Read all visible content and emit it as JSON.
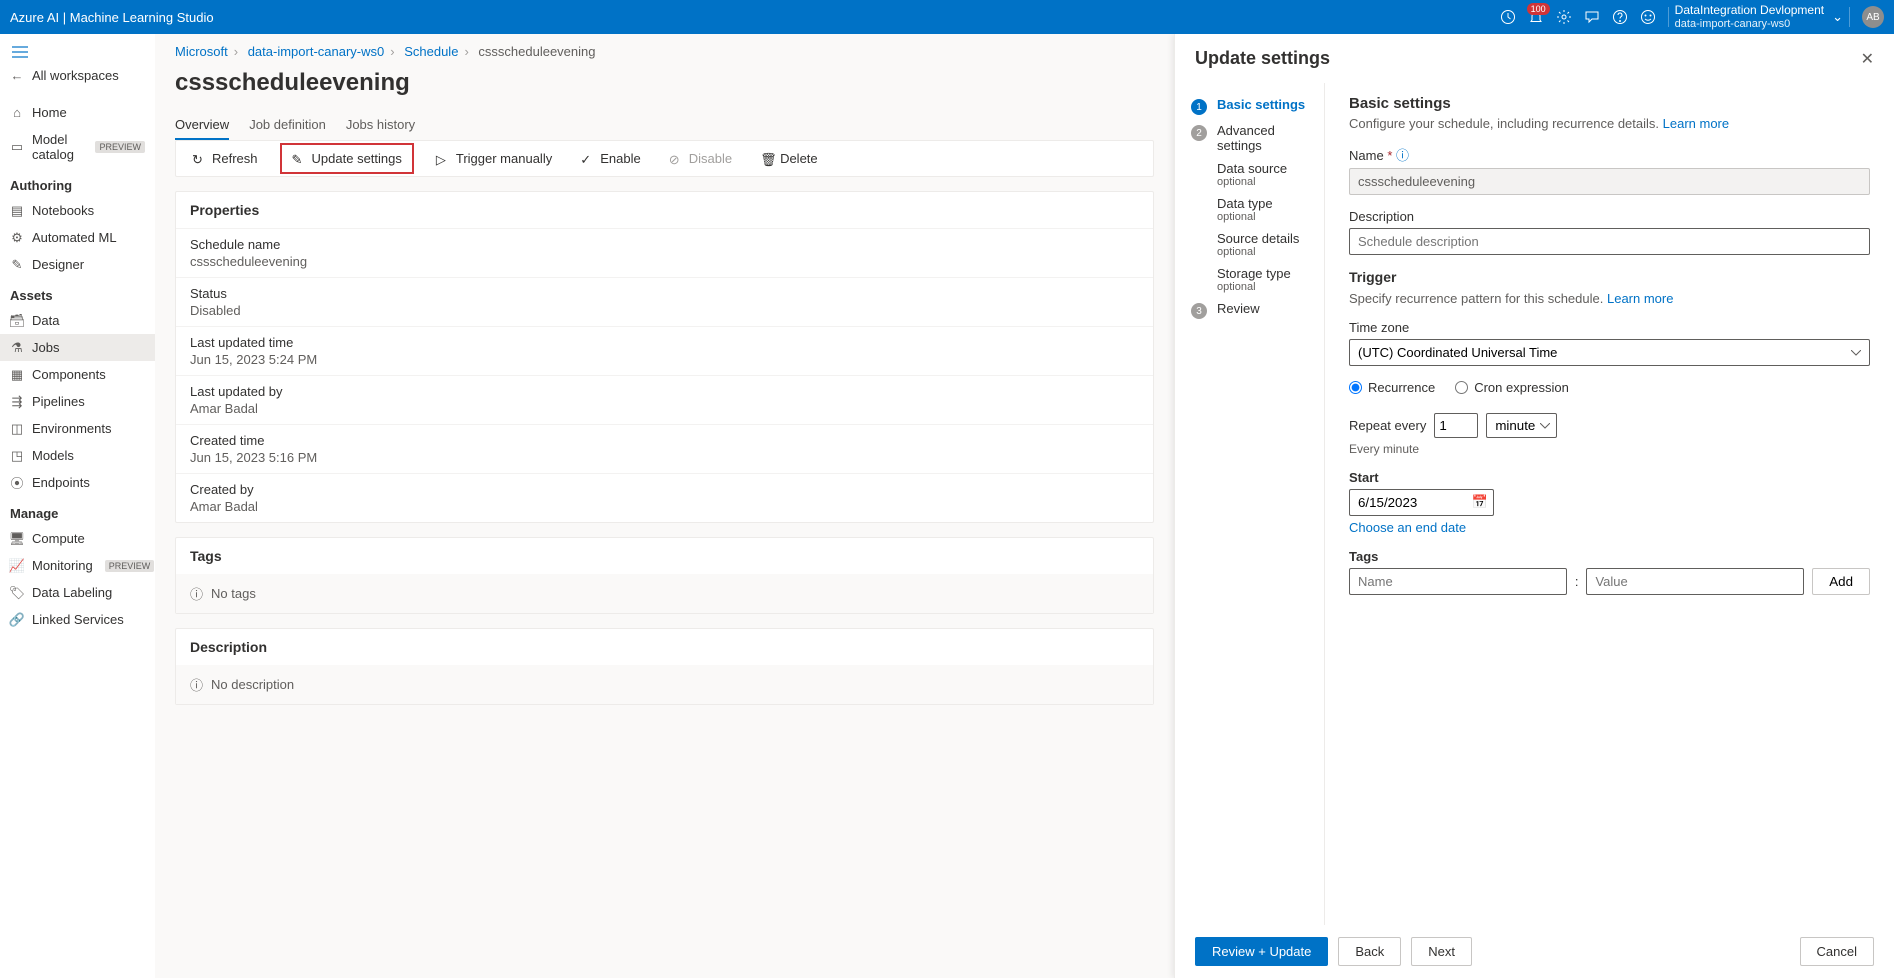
{
  "header": {
    "brand": "Azure AI | Machine Learning Studio",
    "notification_count": "100",
    "tenant": "DataIntegration Devlopment",
    "workspace": "data-import-canary-ws0",
    "avatar_initials": "AB"
  },
  "nav": {
    "all_workspaces": "All workspaces",
    "home": "Home",
    "model_catalog": "Model catalog",
    "preview_badge": "PREVIEW",
    "section_authoring": "Authoring",
    "notebooks": "Notebooks",
    "automated_ml": "Automated ML",
    "designer": "Designer",
    "section_assets": "Assets",
    "data": "Data",
    "jobs": "Jobs",
    "components": "Components",
    "pipelines": "Pipelines",
    "environments": "Environments",
    "models": "Models",
    "endpoints": "Endpoints",
    "section_manage": "Manage",
    "compute": "Compute",
    "monitoring": "Monitoring",
    "data_labeling": "Data Labeling",
    "linked_services": "Linked Services"
  },
  "breadcrumb": {
    "microsoft": "Microsoft",
    "workspace": "data-import-canary-ws0",
    "schedule": "Schedule",
    "current": "cssscheduleevening"
  },
  "page_title": "cssscheduleevening",
  "tabs": {
    "overview": "Overview",
    "job_def": "Job definition",
    "jobs_history": "Jobs history"
  },
  "toolbar": {
    "refresh": "Refresh",
    "update_settings": "Update settings",
    "trigger_manually": "Trigger manually",
    "enable": "Enable",
    "disable": "Disable",
    "delete": "Delete"
  },
  "properties": {
    "title": "Properties",
    "schedule_name_k": "Schedule name",
    "schedule_name_v": "cssscheduleevening",
    "status_k": "Status",
    "status_v": "Disabled",
    "last_updated_time_k": "Last updated time",
    "last_updated_time_v": "Jun 15, 2023 5:24 PM",
    "last_updated_by_k": "Last updated by",
    "last_updated_by_v": "Amar Badal",
    "created_time_k": "Created time",
    "created_time_v": "Jun 15, 2023 5:16 PM",
    "created_by_k": "Created by",
    "created_by_v": "Amar Badal"
  },
  "tags_card": {
    "title": "Tags",
    "empty": "No tags"
  },
  "desc_card": {
    "title": "Description",
    "empty": "No description"
  },
  "panel": {
    "title": "Update settings",
    "steps": {
      "basic": "Basic settings",
      "advanced": "Advanced settings",
      "data_source": "Data source",
      "data_type": "Data type",
      "source_details": "Source details",
      "storage_type": "Storage type",
      "optional": "optional",
      "review": "Review"
    },
    "form": {
      "h_basic": "Basic settings",
      "sub_basic": "Configure your schedule, including recurrence details.",
      "learn_more": "Learn more",
      "name_label": "Name",
      "name_value": "cssscheduleevening",
      "desc_label": "Description",
      "desc_placeholder": "Schedule description",
      "trigger_h": "Trigger",
      "trigger_sub": "Specify recurrence pattern for this schedule.",
      "tz_label": "Time zone",
      "tz_value": "(UTC) Coordinated Universal Time",
      "radio_recurrence": "Recurrence",
      "radio_cron": "Cron expression",
      "repeat_label": "Repeat every",
      "repeat_value": "1",
      "repeat_unit": "minute",
      "repeat_hint": "Every minute",
      "start_label": "Start",
      "start_value": "6/15/2023",
      "end_link": "Choose an end date",
      "tags_label": "Tags",
      "tags_name_ph": "Name",
      "tags_value_ph": "Value",
      "tags_add": "Add"
    },
    "footer": {
      "review_update": "Review + Update",
      "back": "Back",
      "next": "Next",
      "cancel": "Cancel"
    }
  }
}
